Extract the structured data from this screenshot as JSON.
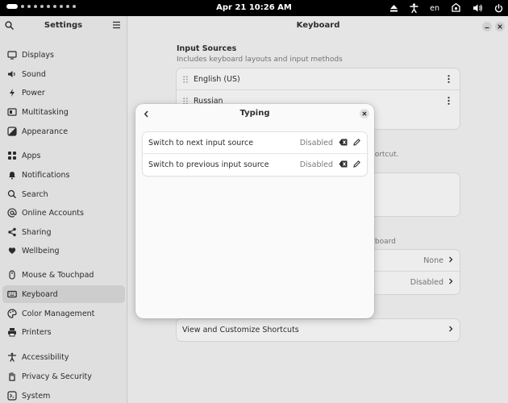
{
  "topbar": {
    "clock": "Apr 21  10:26 AM",
    "language": "en",
    "workspace_dots": 10
  },
  "sidebar": {
    "title": "Settings",
    "items": [
      {
        "label": "Displays",
        "icon": "display-icon"
      },
      {
        "label": "Sound",
        "icon": "speaker-icon"
      },
      {
        "label": "Power",
        "icon": "power-icon"
      },
      {
        "label": "Multitasking",
        "icon": "multitasking-icon"
      },
      {
        "label": "Appearance",
        "icon": "appearance-icon"
      },
      {
        "label": "Apps",
        "icon": "apps-grid-icon"
      },
      {
        "label": "Notifications",
        "icon": "bell-icon"
      },
      {
        "label": "Search",
        "icon": "search-icon"
      },
      {
        "label": "Online Accounts",
        "icon": "at-icon"
      },
      {
        "label": "Sharing",
        "icon": "share-icon"
      },
      {
        "label": "Wellbeing",
        "icon": "wellbeing-icon"
      },
      {
        "label": "Mouse & Touchpad",
        "icon": "mouse-icon"
      },
      {
        "label": "Keyboard",
        "icon": "keyboard-icon",
        "selected": true
      },
      {
        "label": "Color Management",
        "icon": "palette-icon"
      },
      {
        "label": "Printers",
        "icon": "printer-icon"
      },
      {
        "label": "Accessibility",
        "icon": "accessibility-icon"
      },
      {
        "label": "Privacy & Security",
        "icon": "hand-icon"
      },
      {
        "label": "System",
        "icon": "system-icon"
      }
    ]
  },
  "main": {
    "title": "Keyboard",
    "input_sources": {
      "title": "Input Sources",
      "subtitle": "Includes keyboard layouts and input methods",
      "sources": [
        "English (US)",
        "Russian"
      ]
    },
    "hint_partial_1": "hortcut.",
    "hint_partial_2": "eyboard",
    "rows": [
      {
        "value": "None"
      },
      {
        "value": "Disabled"
      }
    ],
    "view_shortcuts": "View and Customize Shortcuts"
  },
  "dialog": {
    "title": "Typing",
    "rows": [
      {
        "label": "Switch to next input source",
        "value": "Disabled"
      },
      {
        "label": "Switch to previous input source",
        "value": "Disabled"
      }
    ]
  },
  "colors": {
    "topbar": "#000000",
    "sidebar_bg": "#ebebeb",
    "selected_bg": "#d8d8d8",
    "card_bg": "#fafafa"
  }
}
